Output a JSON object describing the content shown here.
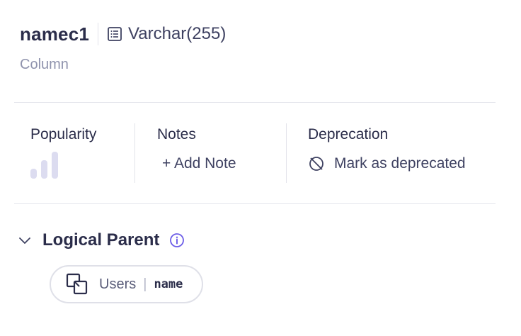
{
  "header": {
    "column_name": "namec1",
    "data_type": "Varchar(255)",
    "subtitle": "Column"
  },
  "stats": {
    "popularity": {
      "title": "Popularity",
      "level": 0
    },
    "notes": {
      "title": "Notes",
      "action": "+ Add Note"
    },
    "deprecation": {
      "title": "Deprecation",
      "action": "Mark as deprecated"
    }
  },
  "logical_parent": {
    "title": "Logical Parent",
    "parent": {
      "table": "Users",
      "separator": "|",
      "column": "name"
    }
  },
  "icons": {
    "type": "list-icon",
    "deprecate": "ban-icon",
    "chevron": "chevron-down-icon",
    "info": "info-icon",
    "chip": "linked-squares-icon"
  },
  "colors": {
    "text_primary": "#2b2d4a",
    "text_secondary": "#8f93ad",
    "accent": "#6b5ce7",
    "popularity_bar": "#dcdcf0"
  }
}
